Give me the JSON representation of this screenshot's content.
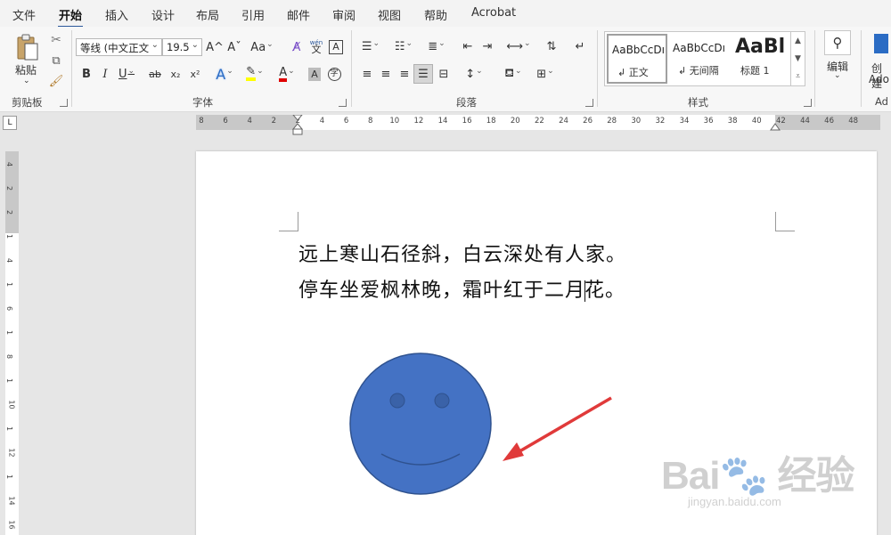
{
  "tabs": [
    "文件",
    "开始",
    "插入",
    "设计",
    "布局",
    "引用",
    "邮件",
    "审阅",
    "视图",
    "帮助",
    "Acrobat"
  ],
  "active_tab": "开始",
  "clipboard": {
    "paste_label": "粘贴",
    "group_label": "剪贴板"
  },
  "font": {
    "name": "等线 (中文正文",
    "size": "19.5",
    "group_label": "字体",
    "grow_icon": "A^",
    "shrink_icon": "Aˇ",
    "case_icon": "Aa",
    "phonetic_top": "wén",
    "phonetic_bottom": "文",
    "border_char": "A",
    "bold": "B",
    "italic": "I",
    "underline": "U",
    "strike": "ab",
    "subscript": "x₂",
    "superscript": "x²",
    "text_effects": "A",
    "font_color": "A",
    "shading_char": "A",
    "enclose_char": "字"
  },
  "paragraph": {
    "group_label": "段落"
  },
  "styles": {
    "group_label": "样式",
    "items": [
      {
        "sample": "AaBbCcDı",
        "name": "↲ 正文"
      },
      {
        "sample": "AaBbCcDı",
        "name": "↲ 无间隔"
      },
      {
        "sample": "AaBl",
        "name": "标题 1"
      }
    ]
  },
  "editing": {
    "label": "编辑"
  },
  "acrobat": {
    "label_top": "创建",
    "label_bottom": "Ado",
    "group_label": "Ad"
  },
  "ruler": {
    "ticks": [
      "8",
      "6",
      "4",
      "2",
      "2",
      "4",
      "6",
      "8",
      "10",
      "12",
      "14",
      "16",
      "18",
      "20",
      "22",
      "24",
      "26",
      "28",
      "30",
      "32",
      "34",
      "36",
      "38",
      "40",
      "42",
      "44",
      "46",
      "48"
    ],
    "vticks": [
      "4",
      "2",
      "2",
      "1",
      "4",
      "1",
      "6",
      "1",
      "8",
      "1",
      "10",
      "1",
      "12",
      "1",
      "14",
      "16"
    ]
  },
  "document": {
    "line1": "远上寒山石径斜，白云深处有人家。",
    "line2_before": "停车坐爱枫林晚，霜叶红于二月",
    "line2_after": "花。"
  },
  "shape": {
    "type": "smiley-face",
    "fill": "#4472c4",
    "stroke": "#2f528f"
  },
  "arrow": {
    "color": "#e03a3a"
  },
  "watermark": {
    "line1": "Bai🐾 经验",
    "line2": "jingyan.baidu.com"
  },
  "colors": {
    "accent": "#2b579a",
    "highlight": "#ffff00",
    "font_red": "#e00000"
  }
}
